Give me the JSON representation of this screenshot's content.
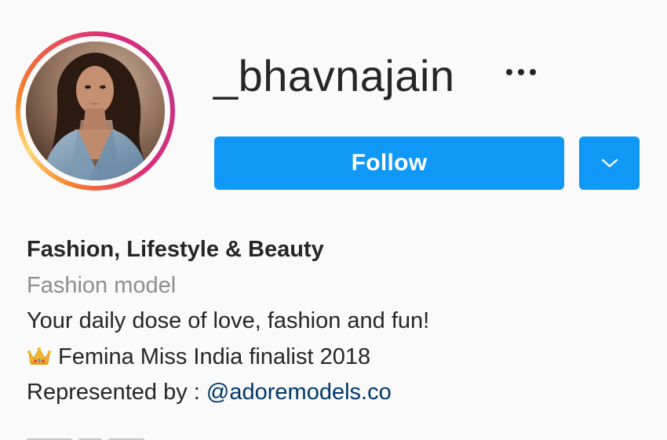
{
  "profile": {
    "username": "_bhavnajain",
    "follow_label": "Follow",
    "full_name": "Fashion, Lifestyle & Beauty",
    "category": "Fashion model",
    "bio_lines": [
      "Your daily dose of love, fashion and fun!",
      "Femina Miss India finalist 2018"
    ],
    "represented_prefix": "Represented by : ",
    "represented_mention": "@adoremodels.co"
  },
  "icons": {
    "more": "more-horizontal-icon",
    "dropdown": "chevron-down-icon",
    "crown": "crown-emoji-icon"
  },
  "colors": {
    "follow_button": "#0f98f5",
    "mention_link": "#00376b",
    "category_text": "#8e8e8e",
    "text": "#262626",
    "background": "#fafafa"
  }
}
